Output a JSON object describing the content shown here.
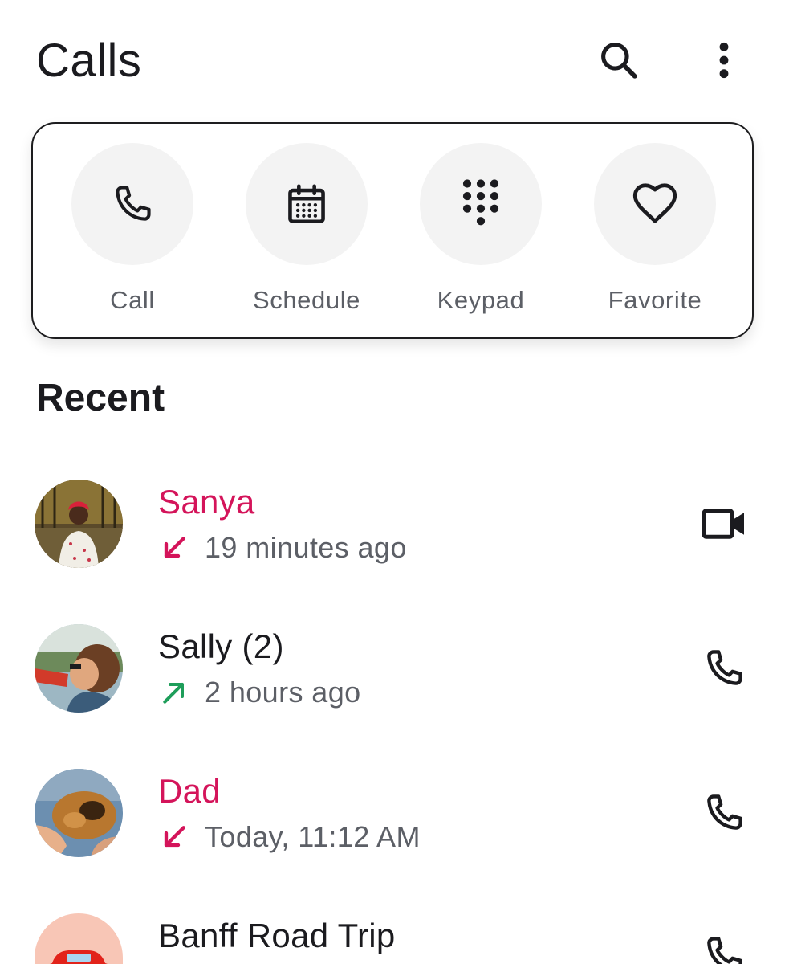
{
  "app_bar": {
    "title": "Calls",
    "search_icon": "search-icon",
    "more_icon": "more-vert-icon"
  },
  "quick_actions": [
    {
      "label": "Call",
      "icon": "phone-icon"
    },
    {
      "label": "Schedule",
      "icon": "calendar-icon"
    },
    {
      "label": "Keypad",
      "icon": "dialpad-icon"
    },
    {
      "label": "Favorite",
      "icon": "heart-icon"
    }
  ],
  "recent": {
    "title": "Recent",
    "items": [
      {
        "name": "Sanya",
        "time": "19 minutes ago",
        "direction": "incoming-missed",
        "action_icon": "videocam-icon"
      },
      {
        "name": "Sally (2)",
        "time": "2 hours ago",
        "direction": "outgoing",
        "action_icon": "phone-icon"
      },
      {
        "name": "Dad",
        "time": "Today, 11:12 AM",
        "direction": "incoming-missed",
        "action_icon": "phone-icon"
      },
      {
        "name": "Banff Road Trip",
        "time": "",
        "direction": "",
        "action_icon": "phone-icon"
      }
    ]
  },
  "colors": {
    "missed": "#d4145a",
    "outgoing": "#1e9e5a",
    "secondary_text": "#5c5f66",
    "action_circle": "#f3f3f3"
  }
}
